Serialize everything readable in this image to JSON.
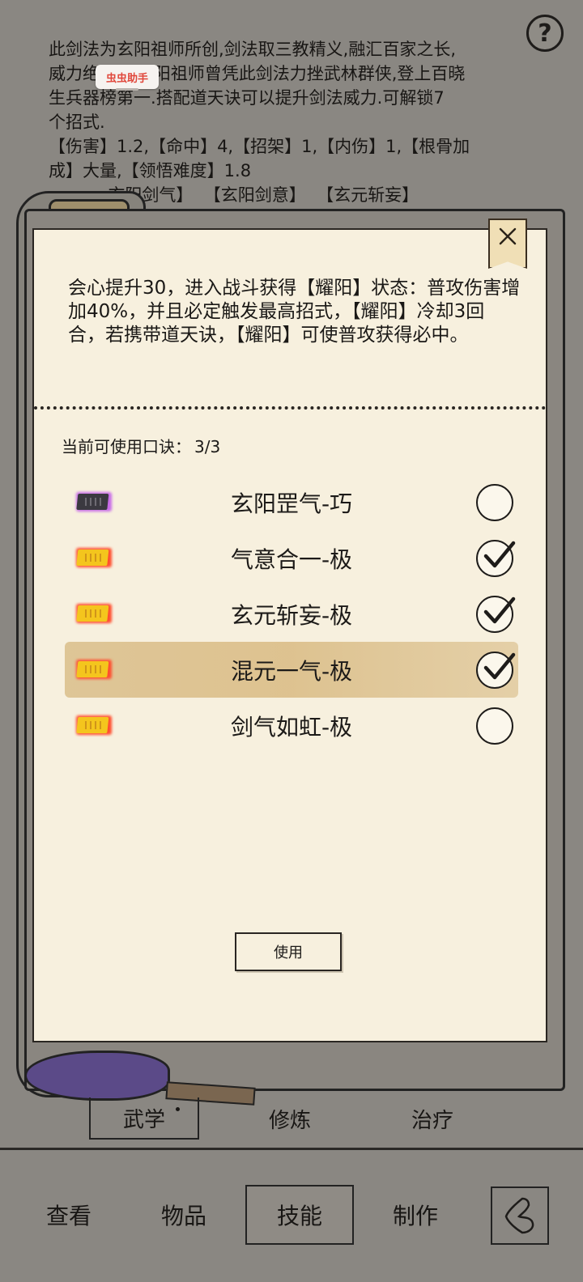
{
  "background": {
    "description_lines": [
      "此剑法为玄阳祖师所创,剑法取三教精义,融汇百家之长,",
      "威力绝          阳祖师曾凭此剑法力挫武林群侠,登上百晓",
      "生兵器榜第一.搭配道天诀可以提升剑法威力.可解锁7",
      "个招式.",
      "【伤害】1.2,【命中】4,【招架】1,【内伤】1,【根骨加",
      "成】大量,【领悟难度】1.8",
      "           玄阳剑气】  【玄阳剑意】  【玄元斩妄】"
    ],
    "overlay_badge": "虫虫助手",
    "help_icon": "?"
  },
  "modal": {
    "close_label": "×",
    "description": "会心提升30，进入战斗获得【耀阳】状态：普攻伤害增加40%，并且必定触发最高招式，【耀阳】冷却3回合，若携带道天诀，【耀阳】可使普攻获得必中。",
    "count_label": "当前可使用口诀：",
    "count_value": "3/3",
    "skills": [
      {
        "name": "玄阳罡气-巧",
        "icon": "purple-scroll-icon",
        "checked": false,
        "selected": false
      },
      {
        "name": "气意合一-极",
        "icon": "gold-scroll-icon",
        "checked": true,
        "selected": false
      },
      {
        "name": "玄元斩妄-极",
        "icon": "gold-scroll-icon",
        "checked": true,
        "selected": false
      },
      {
        "name": "混元一气-极",
        "icon": "gold-scroll-icon",
        "checked": true,
        "selected": true
      },
      {
        "name": "剑气如虹-极",
        "icon": "gold-scroll-icon",
        "checked": false,
        "selected": false
      }
    ],
    "use_button": "使用"
  },
  "sub_tabs": [
    "武学",
    "修炼",
    "治疗"
  ],
  "bottom_nav": [
    "查看",
    "物品",
    "技能",
    "制作"
  ],
  "colors": {
    "modal_bg": "#f7f0de",
    "selected_row": "#dabe8a",
    "gold_icon": "#f2c21e",
    "purple_icon": "#b055d8",
    "backdrop": "#8a8782"
  }
}
